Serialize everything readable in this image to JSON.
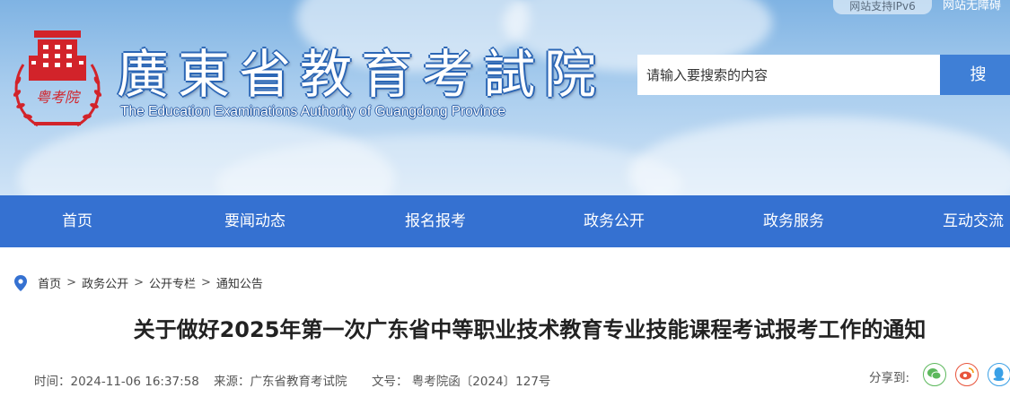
{
  "header": {
    "ipv6_badge": "网站支持IPv6",
    "accessibility_link": "网站无障碍",
    "emblem_text": "粤考院",
    "site_title": "廣東省教育考試院",
    "site_subtitle": "The Education Examinations Authority of Guangdong Province",
    "search": {
      "placeholder": "请输入要搜索的内容",
      "button_label": "搜"
    }
  },
  "nav": {
    "items": [
      "首页",
      "要闻动态",
      "报名报考",
      "政务公开",
      "政务服务",
      "互动交流"
    ]
  },
  "breadcrumb": {
    "items": [
      "首页",
      "政务公开",
      "公开专栏",
      "通知公告"
    ],
    "separator": ">"
  },
  "article": {
    "title": "关于做好2025年第一次广东省中等职业技术教育专业技能课程考试报考工作的通知",
    "time": "时间：2024-11-06 16:37:58",
    "source": "来源：广东省教育考试院",
    "doc_number": "文号： 粤考院函〔2024〕127号",
    "share_label": "分享到:"
  },
  "colors": {
    "nav_bg": "#3571d1",
    "search_button": "#3f7fd6",
    "emblem_red": "#d2232a",
    "wechat": "#5cb85c",
    "weibo": "#e8543c",
    "qq": "#3aa0e6"
  },
  "share_icons": [
    "wechat-icon",
    "weibo-icon",
    "qq-icon"
  ]
}
